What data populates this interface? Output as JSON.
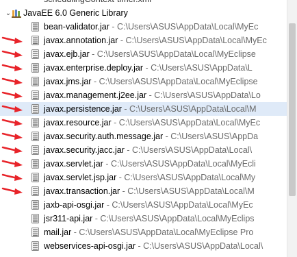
{
  "top_partial": "schedulingContext-timer.xml",
  "library": {
    "name": "JavaEE 6.0 Generic Library"
  },
  "jars": [
    {
      "name": "bean-validator.jar",
      "path": " - C:\\Users\\ASUS\\AppData\\Local\\MyEc"
    },
    {
      "name": "javax.annotation.jar",
      "path": " - C:\\Users\\ASUS\\AppData\\Local\\MyEc"
    },
    {
      "name": "javax.ejb.jar",
      "path": " - C:\\Users\\ASUS\\AppData\\Local\\MyEclipse"
    },
    {
      "name": "javax.enterprise.deploy.jar",
      "path": " - C:\\Users\\ASUS\\AppData\\L"
    },
    {
      "name": "javax.jms.jar",
      "path": " - C:\\Users\\ASUS\\AppData\\Local\\MyEclipse"
    },
    {
      "name": "javax.management.j2ee.jar",
      "path": " - C:\\Users\\ASUS\\AppData\\Lo"
    },
    {
      "name": "javax.persistence.jar",
      "path": " - C:\\Users\\ASUS\\AppData\\Local\\M"
    },
    {
      "name": "javax.resource.jar",
      "path": " - C:\\Users\\ASUS\\AppData\\Local\\MyEc"
    },
    {
      "name": "javax.security.auth.message.jar",
      "path": " - C:\\Users\\ASUS\\AppDa"
    },
    {
      "name": "javax.security.jacc.jar",
      "path": " - C:\\Users\\ASUS\\AppData\\Local\\"
    },
    {
      "name": "javax.servlet.jar",
      "path": " - C:\\Users\\ASUS\\AppData\\Local\\MyEcli"
    },
    {
      "name": "javax.servlet.jsp.jar",
      "path": " - C:\\Users\\ASUS\\AppData\\Local\\My"
    },
    {
      "name": "javax.transaction.jar",
      "path": " - C:\\Users\\ASUS\\AppData\\Local\\M"
    },
    {
      "name": "jaxb-api-osgi.jar",
      "path": " - C:\\Users\\ASUS\\AppData\\Local\\MyEc"
    },
    {
      "name": "jsr311-api.jar",
      "path": " - C:\\Users\\ASUS\\AppData\\Local\\MyEclips"
    },
    {
      "name": "mail.jar",
      "path": " - C:\\Users\\ASUS\\AppData\\Local\\MyEclipse Pro"
    },
    {
      "name": "webservices-api-osgi.jar",
      "path": " - C:\\Users\\ASUS\\AppData\\Local\\"
    }
  ],
  "selected_index": 6,
  "annotation_arrow_color": "#e8242a"
}
